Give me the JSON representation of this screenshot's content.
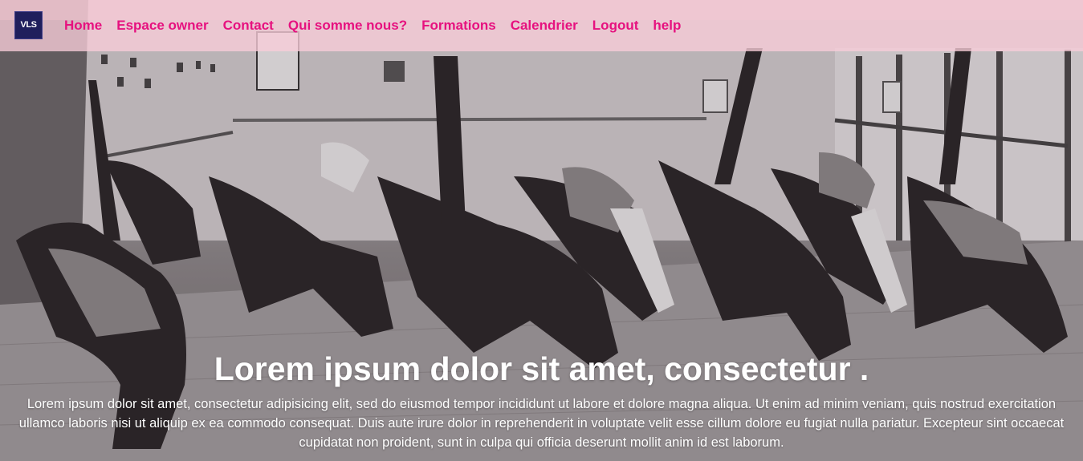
{
  "logo": {
    "text": "VLS"
  },
  "nav": {
    "links": [
      "Home",
      "Espace owner",
      "Contact",
      "Qui somme nous?",
      "Formations",
      "Calendrier",
      "Logout",
      "help"
    ]
  },
  "hero": {
    "title": "Lorem ipsum dolor sit amet, consectetur .",
    "body": "Lorem ipsum dolor sit amet, consectetur adipisicing elit, sed do eiusmod tempor incididunt ut labore et dolore magna aliqua. Ut enim ad minim veniam, quis nostrud exercitation ullamco laboris nisi ut aliquip ex ea commodo consequat. Duis aute irure dolor in reprehenderit in voluptate velit esse cillum dolore eu fugiat nulla pariatur. Excepteur sint occaecat cupidatat non proident, sunt in culpa qui officia deserunt mollit anim id est laborum."
  },
  "colors": {
    "nav_link": "#e6117f",
    "nav_bg": "#f8cdd8",
    "logo_bg": "#1f1f5c"
  },
  "icons": {
    "hero_image": "dance-class-photo"
  }
}
